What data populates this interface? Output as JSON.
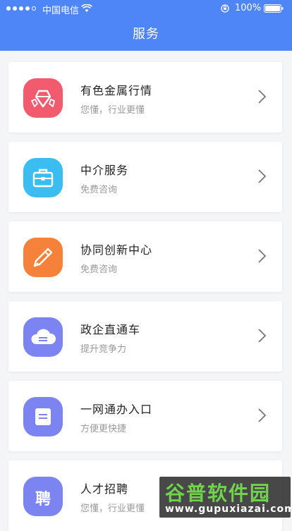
{
  "status_bar": {
    "carrier": "中国电信",
    "battery": "100%"
  },
  "header": {
    "title": "服务"
  },
  "services": [
    {
      "title": "有色金属行情",
      "subtitle": "您懂，行业更懂",
      "icon": "crystal-icon",
      "color": "#f25b6d"
    },
    {
      "title": "中介服务",
      "subtitle": "免费咨询",
      "icon": "briefcase-icon",
      "color": "#3cbdf2"
    },
    {
      "title": "协同创新中心",
      "subtitle": "免费咨询",
      "icon": "pen-icon",
      "color": "#f5813a"
    },
    {
      "title": "政企直通车",
      "subtitle": "提升竞争力",
      "icon": "cloud-icon",
      "color": "#7b84f1"
    },
    {
      "title": "一网通办入口",
      "subtitle": "方便更快捷",
      "icon": "document-icon",
      "color": "#7b84f1"
    },
    {
      "title": "人才招聘",
      "subtitle": "您懂，行业更懂",
      "icon": "hire-icon",
      "icon_text": "聘",
      "color": "#7b84f1"
    }
  ],
  "watermark": {
    "main": "谷普软件园",
    "url": "www.gupuxiazai.com"
  },
  "colors": {
    "header": "#4f86f7",
    "background": "#f4f5f7"
  }
}
